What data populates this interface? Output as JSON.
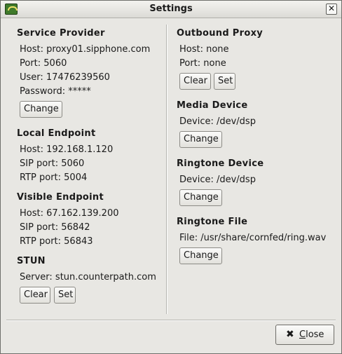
{
  "window": {
    "title": "Settings",
    "close_glyph": "✕"
  },
  "service_provider": {
    "title": "Service Provider",
    "host": "Host: proxy01.sipphone.com",
    "port": "Port: 5060",
    "user": "User: 17476239560",
    "password": "Password: *****",
    "change_label": "Change"
  },
  "local_endpoint": {
    "title": "Local Endpoint",
    "host": "Host: 192.168.1.120",
    "sip_port": "SIP port: 5060",
    "rtp_port": "RTP port: 5004"
  },
  "visible_endpoint": {
    "title": "Visible Endpoint",
    "host": "Host: 67.162.139.200",
    "sip_port": "SIP port: 56842",
    "rtp_port": "RTP port: 56843"
  },
  "stun": {
    "title": "STUN",
    "server": "Server: stun.counterpath.com",
    "clear_label": "Clear",
    "set_label": "Set"
  },
  "outbound_proxy": {
    "title": "Outbound Proxy",
    "host": "Host: none",
    "port": "Port: none",
    "clear_label": "Clear",
    "set_label": "Set"
  },
  "media_device": {
    "title": "Media Device",
    "device": "Device: /dev/dsp",
    "change_label": "Change"
  },
  "ringtone_device": {
    "title": "Ringtone Device",
    "device": "Device: /dev/dsp",
    "change_label": "Change"
  },
  "ringtone_file": {
    "title": "Ringtone File",
    "file": "File: /usr/share/cornfed/ring.wav",
    "change_label": "Change"
  },
  "footer": {
    "close_label": "Close",
    "close_icon": "✖"
  }
}
